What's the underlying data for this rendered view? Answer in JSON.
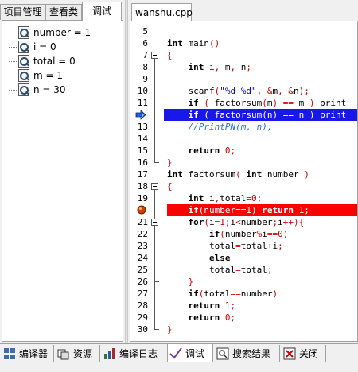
{
  "left_tabs": [
    {
      "label": "项目管理"
    },
    {
      "label": "查看类"
    },
    {
      "label": "调试",
      "active": true
    }
  ],
  "watch_vars": [
    {
      "text": "number = 1"
    },
    {
      "text": "i = 0"
    },
    {
      "text": "total = 0"
    },
    {
      "text": "m = 1"
    },
    {
      "text": "n = 30"
    }
  ],
  "editor": {
    "file_tab": "wanshu.cpp",
    "line_numbers": [
      "5",
      "6",
      "7",
      "8",
      "9",
      "10",
      "11",
      "12",
      "13",
      "14",
      "15",
      "16",
      "17",
      "18",
      "19",
      "20",
      "21",
      "22",
      "23",
      "24",
      "25",
      "26",
      "27",
      "28",
      "29",
      "30"
    ],
    "current_line": "12",
    "breakpoint_line": "20"
  },
  "code_lines": [
    "",
    "int main()",
    "{",
    "    int i, m, n;",
    "",
    "    scanf(\"%d %d\", &m, &n);",
    "    if ( factorsum(m) == m ) print",
    "    if ( factorsum(n) == n ) print",
    "    //PrintPN(m, n);",
    "",
    "    return 0;",
    "}",
    "int factorsum( int number )",
    "{",
    "    int i,total=0;",
    "    if(number==1) return 1;",
    "    for(i=1;i<number;i++){",
    "        if(number%i==0)",
    "        total=total+i;",
    "        else",
    "        total=total;",
    "    }",
    "    if(total==number)",
    "    return 1;",
    "    return 0;",
    "}"
  ],
  "bottom_tabs": [
    {
      "label": "编译器",
      "icon": "compiler-grid-icon"
    },
    {
      "label": "资源",
      "icon": "resources-icon"
    },
    {
      "label": "编译日志",
      "icon": "bar-chart-icon"
    },
    {
      "label": "调试",
      "icon": "checkmark-debug-icon",
      "active": true
    },
    {
      "label": "搜索结果",
      "icon": "search-results-icon"
    },
    {
      "label": "关闭",
      "icon": "close-icon"
    }
  ],
  "colors": {
    "current_line_bg": "#1818e8",
    "breakpoint_bg": "#ff0000",
    "keyword": "#000000",
    "string": "#0000cc",
    "number": "#d00000",
    "comment": "#2f6fd0"
  }
}
